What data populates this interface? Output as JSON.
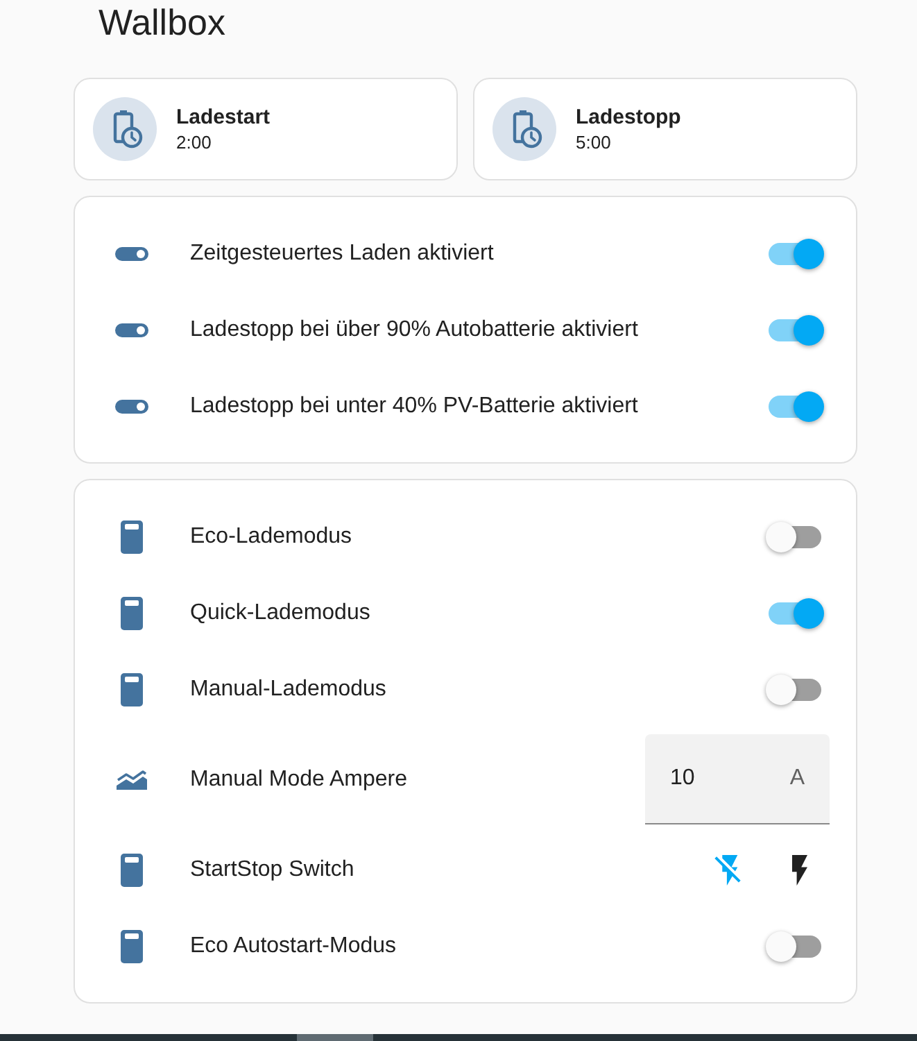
{
  "title": "Wallbox",
  "tiles": [
    {
      "name": "Ladestart",
      "state": "2:00"
    },
    {
      "name": "Ladestopp",
      "state": "5:00"
    }
  ],
  "settings": [
    {
      "kind": "toggle",
      "label": "Zeitgesteuertes Laden aktiviert",
      "on": true
    },
    {
      "kind": "toggle",
      "label": "Ladestopp bei über 90% Autobatterie aktiviert",
      "on": true
    },
    {
      "kind": "toggle",
      "label": "Ladestopp bei unter 40% PV-Batterie aktiviert",
      "on": true
    }
  ],
  "modes": [
    {
      "kind": "toggle",
      "label": "Eco-Lademodus",
      "on": false
    },
    {
      "kind": "toggle",
      "label": "Quick-Lademodus",
      "on": true
    },
    {
      "kind": "toggle",
      "label": "Manual-Lademodus",
      "on": false
    },
    {
      "kind": "number",
      "label": "Manual Mode Ampere",
      "value": "10",
      "unit": "A"
    },
    {
      "kind": "buttons",
      "label": "StartStop Switch",
      "on": false
    },
    {
      "kind": "toggle",
      "label": "Eco Autostart-Modus",
      "on": false
    }
  ]
}
